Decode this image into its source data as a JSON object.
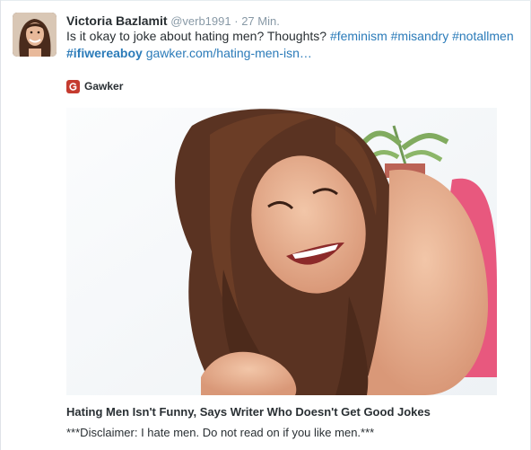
{
  "tweet": {
    "fullname": "Victoria Bazlamit",
    "username": "@verb1991",
    "separator": "·",
    "time": "27 Min.",
    "text_plain": "Is it okay to joke about hating men? Thoughts?",
    "hashtags": [
      "#feminism",
      "#misandry",
      "#notallmen",
      "#ifiwereaboy"
    ],
    "link": "gawker.com/hating-men-isn…"
  },
  "card": {
    "source": "Gawker",
    "title": "Hating Men Isn't Funny, Says Writer Who Doesn't Get Good Jokes",
    "description": "***Disclaimer: I hate men. Do not read on if you like men.***"
  },
  "colors": {
    "link": "#2b7bb9",
    "text": "#292f33",
    "muted": "#8899a6",
    "gawker": "#c53b2f"
  }
}
